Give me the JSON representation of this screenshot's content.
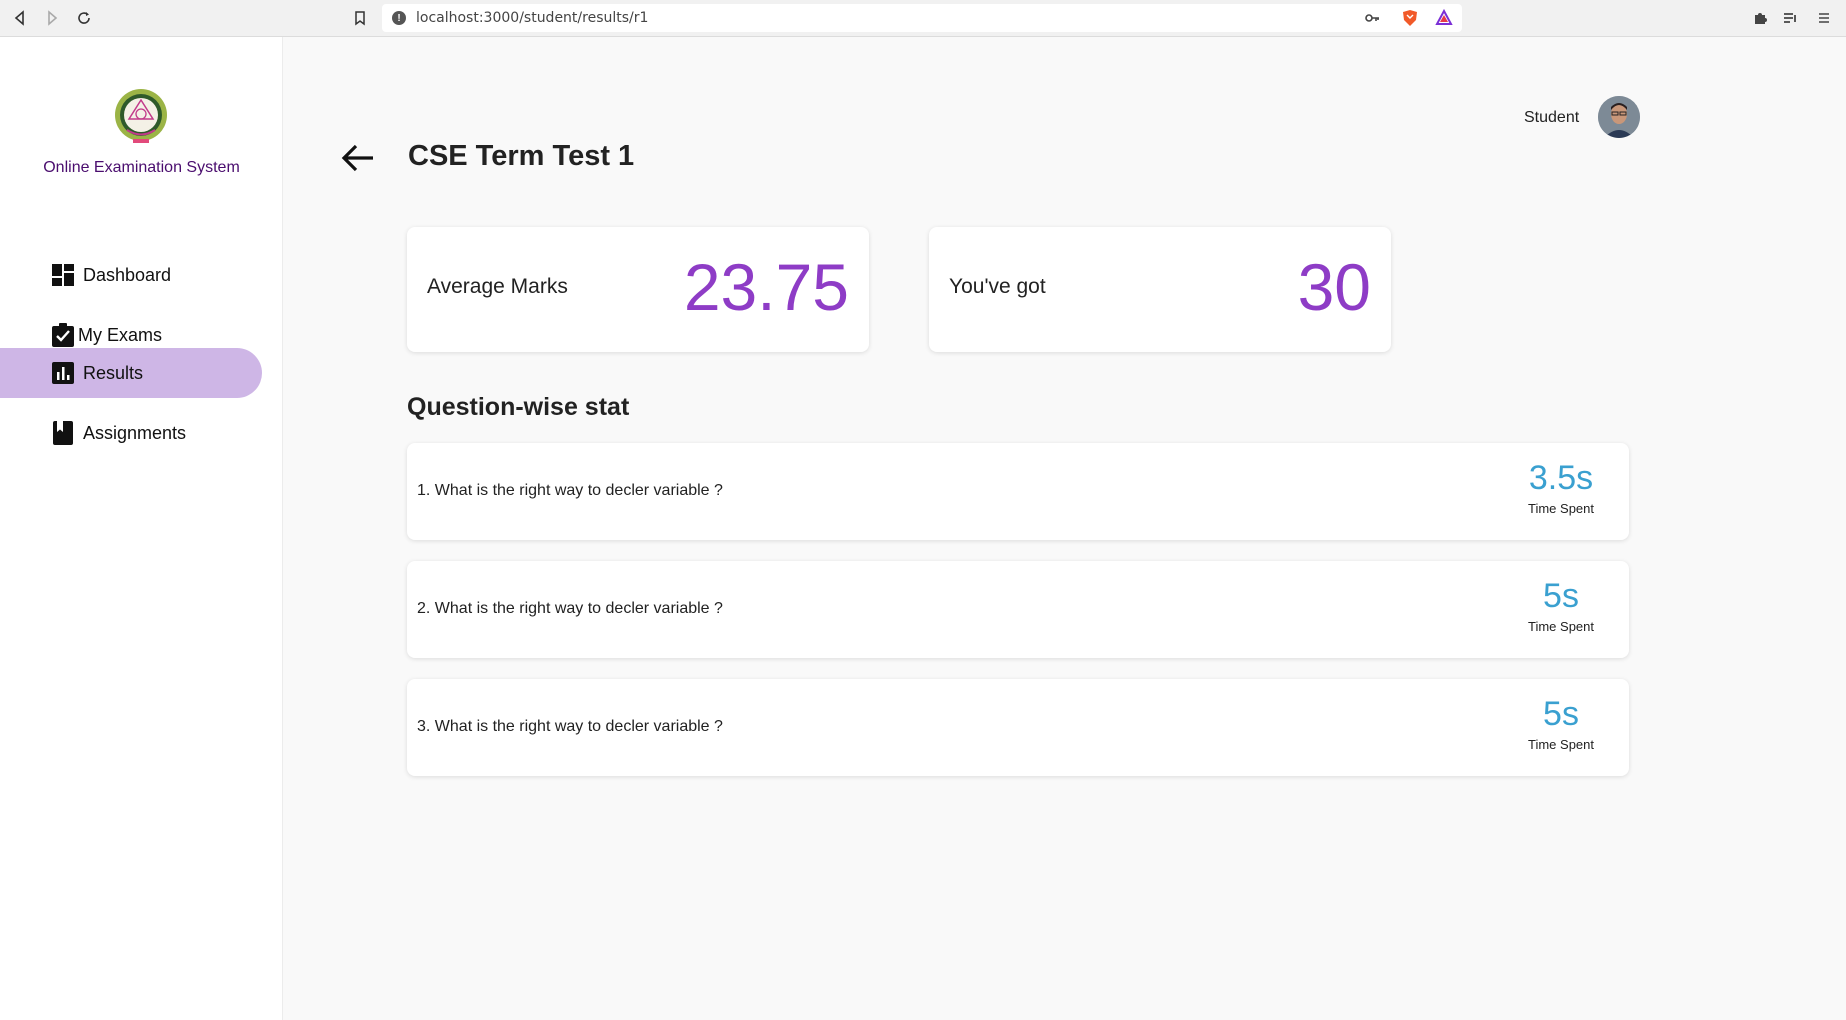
{
  "browser": {
    "url": "localhost:3000/student/results/r1"
  },
  "sidebar": {
    "app_name": "Online Examination System",
    "items": [
      {
        "label": "Dashboard",
        "icon": "dashboard-icon",
        "active": false
      },
      {
        "label": "My Exams",
        "icon": "clipboard-check-icon",
        "active": false
      },
      {
        "label": "Results",
        "icon": "bar-chart-icon",
        "active": true
      },
      {
        "label": "Assignments",
        "icon": "bookmark-book-icon",
        "active": false
      }
    ]
  },
  "header": {
    "user_role": "Student",
    "title": "CSE Term Test 1"
  },
  "stats": {
    "average_label": "Average Marks",
    "average_value": "23.75",
    "got_label": "You've got",
    "got_value": "30"
  },
  "question_stats": {
    "title": "Question-wise stat",
    "items": [
      {
        "text": "1. What is the right way to decler variable ?",
        "time": "3.5s",
        "time_label": "Time Spent"
      },
      {
        "text": "2. What is the right way to decler variable ?",
        "time": "5s",
        "time_label": "Time Spent"
      },
      {
        "text": "3. What is the right way to decler variable ?",
        "time": "5s",
        "time_label": "Time Spent"
      }
    ]
  },
  "colors": {
    "accent_purple": "#8e3cc6",
    "active_nav": "#ceb6e6",
    "time_blue": "#3aa0d0",
    "app_name": "#4a0d6e"
  }
}
